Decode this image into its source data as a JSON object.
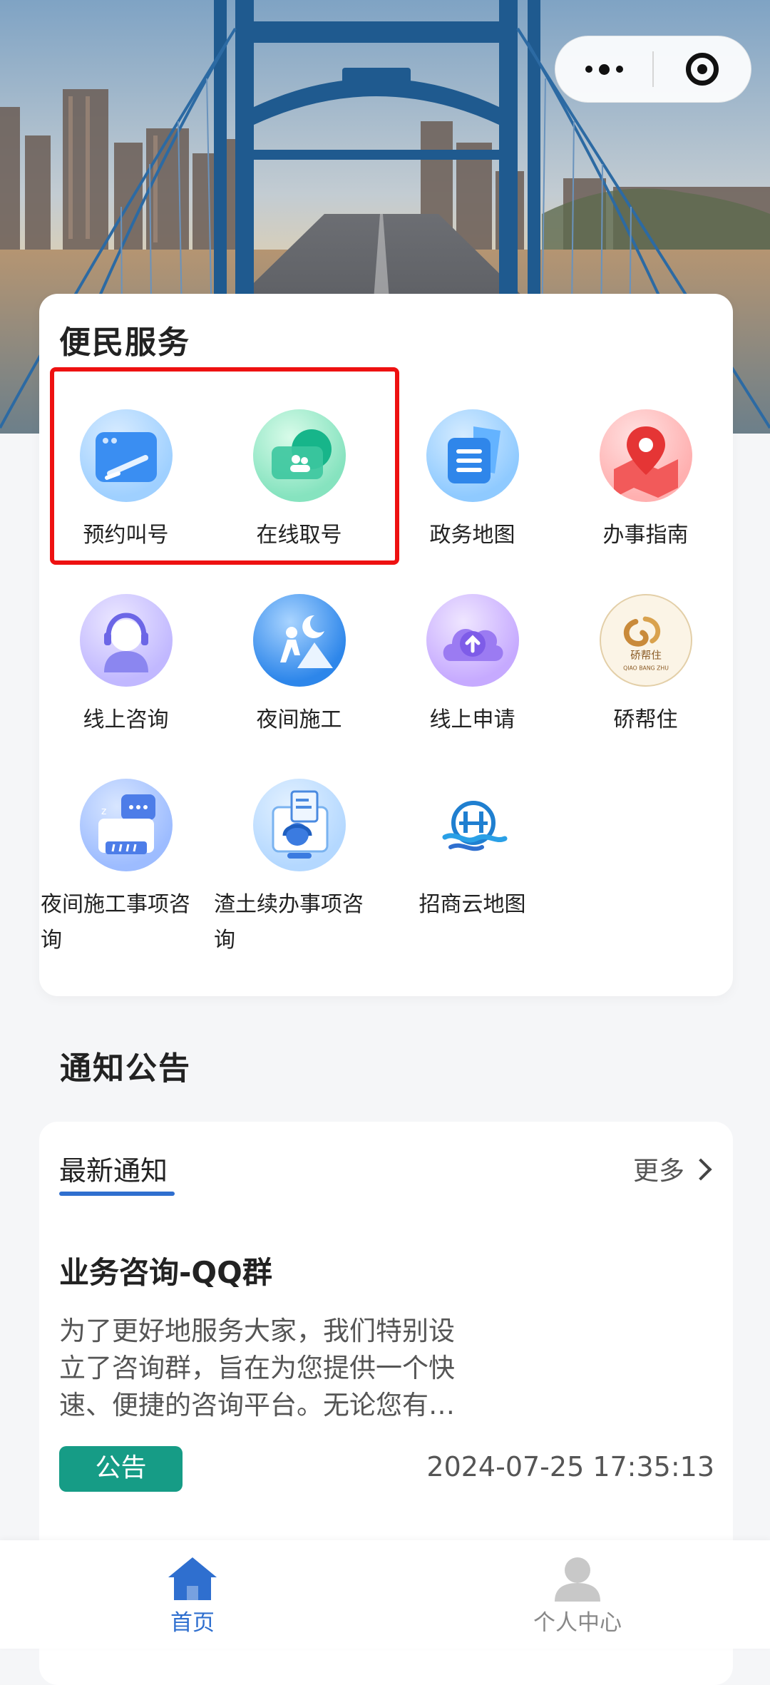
{
  "service": {
    "title": "便民服务",
    "items": [
      {
        "label": "预约叫号",
        "icon": "calendar-booking-icon"
      },
      {
        "label": "在线取号",
        "icon": "queue-ticket-icon"
      },
      {
        "label": "政务地图",
        "icon": "document-map-icon"
      },
      {
        "label": "办事指南",
        "icon": "location-pin-icon"
      },
      {
        "label": "线上咨询",
        "icon": "customer-service-icon"
      },
      {
        "label": "夜间施工",
        "icon": "night-construction-icon"
      },
      {
        "label": "线上申请",
        "icon": "cloud-upload-icon"
      },
      {
        "label": "硚帮住",
        "icon": "qiao-bang-zhu-logo"
      },
      {
        "label": "夜间施工事项咨询",
        "icon": "chat-printer-icon"
      },
      {
        "label": "渣土续办事项咨询",
        "icon": "headset-document-icon"
      },
      {
        "label": "招商云地图",
        "icon": "bridge-wave-logo"
      }
    ]
  },
  "notice": {
    "title": "通知公告",
    "tab_label": "最新通知",
    "more_label": "更多",
    "item": {
      "title": "业务咨询-QQ群",
      "body": "为了更好地服务大家，我们特别设立了咨询群，旨在为您提供一个快速、便捷的咨询平台。无论您有任何疑问、需要政策解读、寻求业务咨询或是想…",
      "badge": "公告",
      "datetime": "2024-07-25 17:35:13"
    }
  },
  "logo_text": "硚帮住",
  "logo_subtext": "QIAO BANG ZHU",
  "tabbar": {
    "home_label": "首页",
    "profile_label": "个人中心"
  },
  "colors": {
    "accent": "#2f6fcf",
    "badge": "#169c86",
    "highlight_border": "#ee1111"
  }
}
